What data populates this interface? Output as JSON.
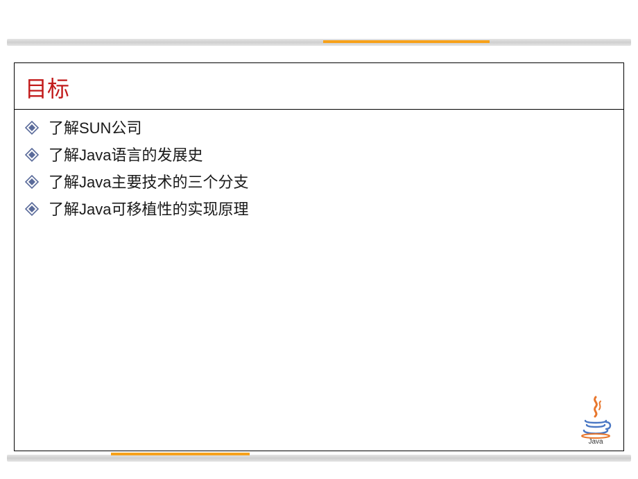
{
  "title": "目标",
  "bullets": {
    "items": [
      {
        "text": "了解SUN公司"
      },
      {
        "text": "了解Java语言的发展史"
      },
      {
        "text": "了解Java主要技术的三个分支"
      },
      {
        "text": "了解Java可移植性的实现原理"
      }
    ]
  },
  "logo": {
    "label": "Java"
  },
  "colors": {
    "title": "#c21b1b",
    "accent": "#f7a11a",
    "bullet_icon": "#5a6b9a"
  }
}
